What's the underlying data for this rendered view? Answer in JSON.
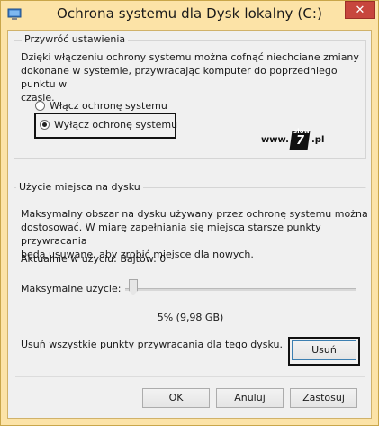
{
  "window": {
    "title": "Ochrona systemu dla Dysk lokalny (C:)",
    "close_label": "✕",
    "accent_color": "#fce3a7",
    "close_color": "#c7463d"
  },
  "restore": {
    "legend": "Przywróć ustawienia",
    "description_line1": "Dzięki włączeniu ochrony systemu można cofnąć niechciane zmiany",
    "description_line2": "dokonane w systemie, przywracając komputer do poprzedniego punktu w",
    "description_line3": "czasie.",
    "options": [
      {
        "label": "Włącz ochronę systemu",
        "checked": false
      },
      {
        "label": "Wyłącz ochronę systemu",
        "checked": true
      }
    ]
  },
  "watermark": {
    "prefix": "www.",
    "logo_small": "słow",
    "logo_big": "7",
    "suffix": ".pl"
  },
  "disk": {
    "legend": "Użycie miejsca na dysku",
    "description_line1": "Maksymalny obszar na dysku używany przez ochronę systemu można",
    "description_line2": "dostosować. W miarę zapełniania się miejsca starsze punkty przywracania",
    "description_line3": "będą usuwane, aby zrobić miejsce dla nowych.",
    "current_usage_label": "Aktualnie w użyciu:",
    "current_usage_value": "Bajtów: 0",
    "max_usage_label": "Maksymalne użycie:",
    "max_usage_fraction": 0.05,
    "max_usage_value": "5% (9,98 GB)",
    "delete_text": "Usuń wszystkie punkty przywracania dla tego dysku.",
    "delete_button": "Usuń"
  },
  "footer": {
    "ok": "OK",
    "cancel": "Anuluj",
    "apply": "Zastosuj"
  }
}
